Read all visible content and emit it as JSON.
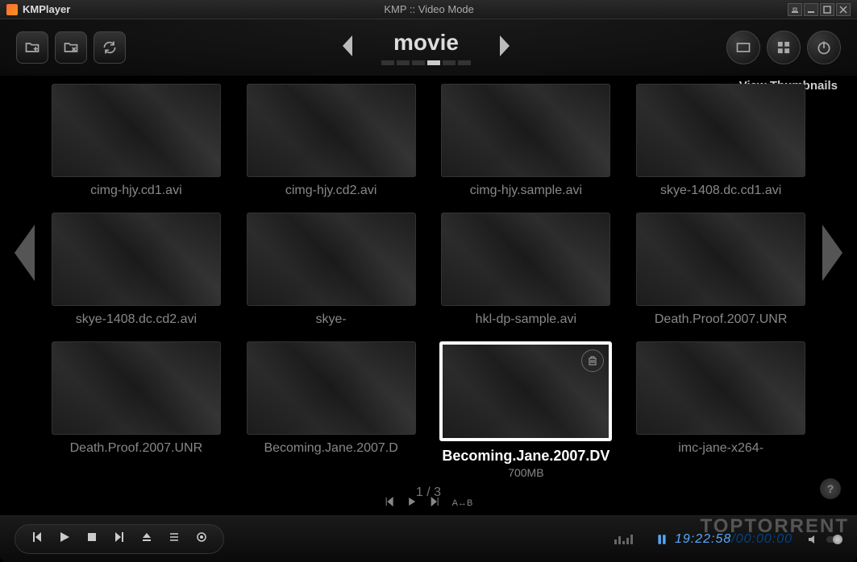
{
  "app": {
    "name": "KMPlayer",
    "title": "KMP :: Video Mode"
  },
  "toolbar": {
    "category": "movie",
    "view_label": "View Thumbnails"
  },
  "dots": {
    "active_index": 3,
    "count": 6
  },
  "thumbs": [
    {
      "label": "cimg-hjy.cd1.avi",
      "selected": false
    },
    {
      "label": "cimg-hjy.cd2.avi",
      "selected": false
    },
    {
      "label": "cimg-hjy.sample.avi",
      "selected": false
    },
    {
      "label": "skye-1408.dc.cd1.avi",
      "selected": false
    },
    {
      "label": "skye-1408.dc.cd2.avi",
      "selected": false
    },
    {
      "label": "skye-",
      "selected": false
    },
    {
      "label": "hkl-dp-sample.avi",
      "selected": false
    },
    {
      "label": "Death.Proof.2007.UNR",
      "selected": false
    },
    {
      "label": "Death.Proof.2007.UNR",
      "selected": false
    },
    {
      "label": "Becoming.Jane.2007.D",
      "selected": false
    },
    {
      "label": "Becoming.Jane.2007.DV",
      "size": "700MB",
      "selected": true
    },
    {
      "label": "imc-jane-x264-",
      "selected": false
    }
  ],
  "pager": "1 / 3",
  "mini": {
    "ab": "A↔B"
  },
  "time": {
    "current": "19:22:58",
    "total": "00:00:00",
    "sep": "/"
  },
  "watermark": "TOPTORRENT",
  "help": "?"
}
